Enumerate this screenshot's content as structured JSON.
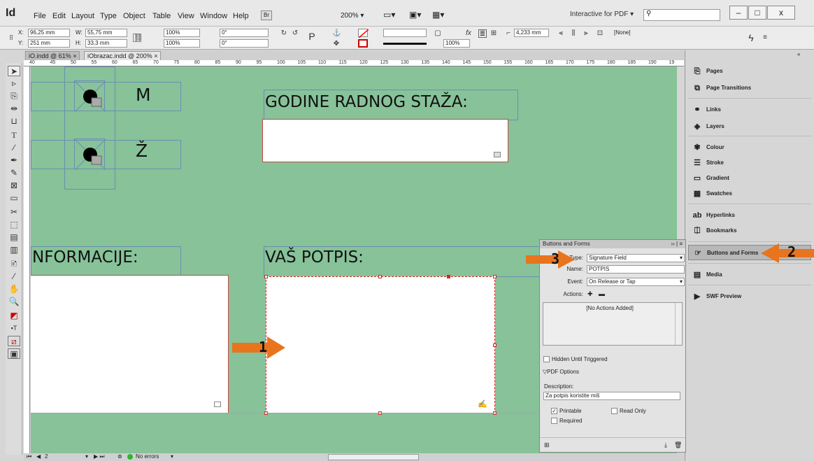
{
  "menubar": {
    "logo": "Id",
    "items": [
      "File",
      "Edit",
      "Layout",
      "Type",
      "Object",
      "Table",
      "View",
      "Window",
      "Help"
    ],
    "br_badge": "Br",
    "zoom": "200%",
    "workspace": "Interactive for PDF",
    "minimize": "–",
    "maximize": "□",
    "close": "x"
  },
  "control": {
    "x": "96,25 mm",
    "y": "251 mm",
    "w": "55,75 mm",
    "h": "33,3 mm",
    "scale_x": "100%",
    "scale_y": "100%",
    "angle": "0°",
    "shear": "0°",
    "opacity": "100%",
    "stroke_weight": "4,233 mm",
    "style": "[None]"
  },
  "tabs": [
    {
      "label": "iO.indd @ 61%"
    },
    {
      "label": "iObrazac.indd @ 200%"
    }
  ],
  "ruler_ticks": [
    "40",
    "45",
    "50",
    "55",
    "60",
    "65",
    "70",
    "75",
    "80",
    "85",
    "90",
    "95",
    "100",
    "105",
    "110",
    "115",
    "120",
    "125",
    "130",
    "135",
    "140",
    "145",
    "150",
    "155",
    "160",
    "165",
    "170",
    "175",
    "180",
    "185",
    "190",
    "19"
  ],
  "canvas": {
    "label_m": "M",
    "label_z": "Ž",
    "godine": "GODINE RADNOG STAŽA:",
    "informacije": "NFORMACIJE:",
    "potpis": "VAŠ POTPIS:"
  },
  "statusbar": {
    "page": "2",
    "errors": "No errors"
  },
  "right_panel": {
    "items": [
      {
        "label": "Pages",
        "icon": "pages-icon"
      },
      {
        "label": "Page Transitions",
        "icon": "page-transitions-icon"
      },
      {
        "label": "Links",
        "icon": "links-icon"
      },
      {
        "label": "Layers",
        "icon": "layers-icon"
      },
      {
        "label": "Colour",
        "icon": "colour-icon"
      },
      {
        "label": "Stroke",
        "icon": "stroke-icon"
      },
      {
        "label": "Gradient",
        "icon": "gradient-icon"
      },
      {
        "label": "Swatches",
        "icon": "swatches-icon"
      },
      {
        "label": "Hyperlinks",
        "icon": "hyperlinks-icon"
      },
      {
        "label": "Bookmarks",
        "icon": "bookmarks-icon"
      },
      {
        "label": "Buttons and Forms",
        "icon": "buttons-forms-icon"
      },
      {
        "label": "Media",
        "icon": "media-icon"
      },
      {
        "label": "SWF Preview",
        "icon": "swf-preview-icon"
      }
    ]
  },
  "bf_panel": {
    "title": "Buttons and Forms",
    "type_label": "Type:",
    "type_value": "Signature Field",
    "name_label": "Name:",
    "name_value": "POTPIS",
    "event_label": "Event:",
    "event_value": "On Release or Tap",
    "actions_label": "Actions:",
    "no_actions": "[No Actions Added]",
    "hidden": "Hidden Until Triggered",
    "pdf_options": "PDF Options",
    "description_label": "Description:",
    "description_value": "Za potpis koristite miš",
    "printable": "Printable",
    "read_only": "Read Only",
    "required": "Required"
  },
  "arrows": {
    "one": "1",
    "two": "2",
    "three": "3"
  },
  "colors": {
    "canvas": "#87c299",
    "arrow": "#e8741e",
    "frame": "#6a8fb0"
  }
}
